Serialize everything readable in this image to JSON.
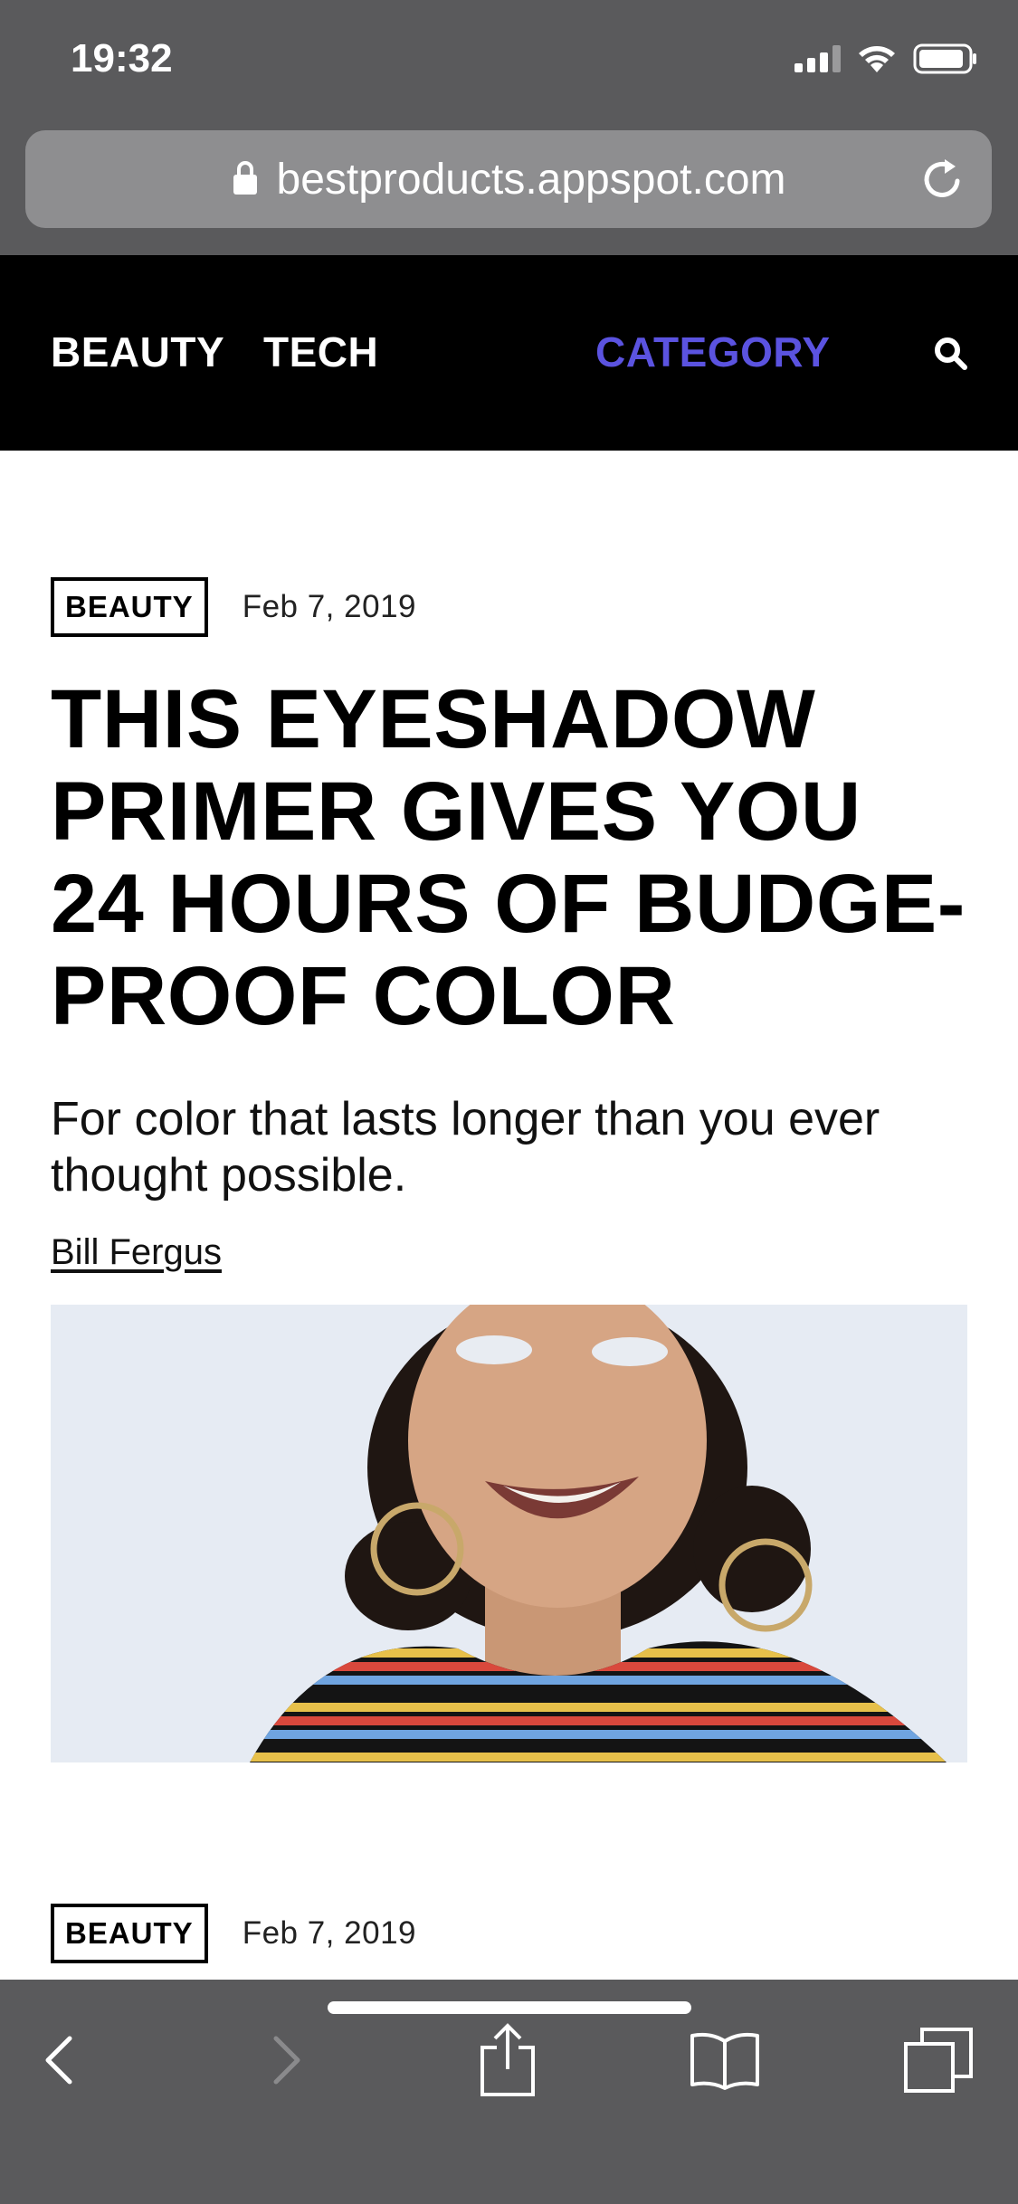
{
  "status_bar": {
    "time": "19:32"
  },
  "browser": {
    "url": "bestproducts.appspot.com"
  },
  "nav": {
    "items": [
      "BEAUTY",
      "TECH"
    ],
    "category_label": "CATEGORY",
    "accent_color": "#5b53e0"
  },
  "article": {
    "tag": "BEAUTY",
    "date": "Feb 7, 2019",
    "headline": "THIS EYESHADOW PRIMER GIVES YOU 24 HOURS OF BUDGE-PROOF COLOR",
    "dek": "For color that lasts longer than you ever thought possible.",
    "author": "Bill Fergus"
  },
  "next_article": {
    "tag": "BEAUTY",
    "date": "Feb 7, 2019"
  },
  "toolbar": {
    "icons": [
      "back-icon",
      "forward-icon",
      "share-icon",
      "bookmarks-icon",
      "tabs-icon"
    ]
  }
}
